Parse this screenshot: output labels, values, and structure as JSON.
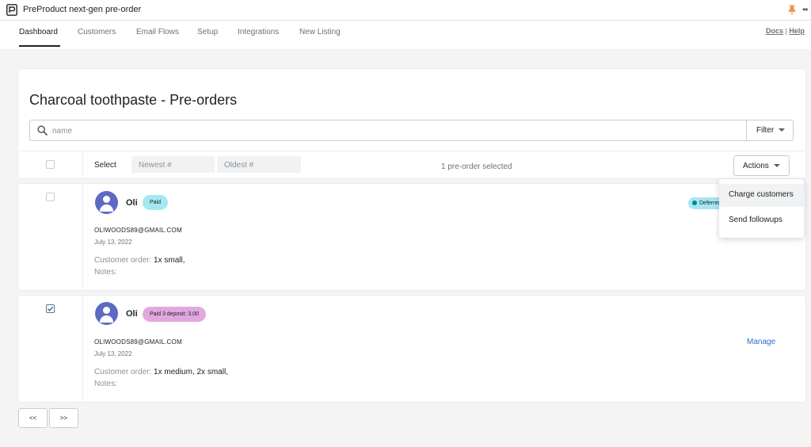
{
  "app": {
    "title": "PreProduct next-gen pre-order",
    "more_label": "••"
  },
  "nav": {
    "tabs": [
      {
        "label": "Dashboard"
      },
      {
        "label": "Customers"
      },
      {
        "label": "Email Flows"
      },
      {
        "label": "Setup"
      },
      {
        "label": "Integrations"
      },
      {
        "label": "New Listing"
      }
    ],
    "active_tab": "Dashboard",
    "docs_label": "Docs",
    "separator": "|",
    "help_label": "Help"
  },
  "page": {
    "title": "Charcoal toothpaste - Pre-orders",
    "search": {
      "placeholder": "name",
      "value": ""
    },
    "filter_label": "Filter"
  },
  "toolbar": {
    "select_label": "Select",
    "newest_placeholder": "Newest #",
    "oldest_placeholder": "Oldest #",
    "selected_info": "1 pre-order selected",
    "actions_label": "Actions"
  },
  "actions_menu": {
    "items": [
      {
        "label": "Charge customers"
      },
      {
        "label": "Send followups"
      }
    ]
  },
  "orders": [
    {
      "name": "Oli",
      "badge": "Paid",
      "badge_color": "#a4e8f2",
      "status": "Deferred",
      "email": "OLIWOODS89@GMAIL.COM",
      "date": "July 13, 2022",
      "order_label": "Customer order:",
      "order_value": " 1x small,",
      "notes_label": "Notes:",
      "checked": false
    },
    {
      "name": "Oli",
      "badge": "Paid 3 deposit: 3.00",
      "badge_color": "#e3a7e0",
      "email": "OLIWOODS89@GMAIL.COM",
      "date": "July 13, 2022",
      "order_label": "Customer order:",
      "order_value": " 1x medium, 2x small,",
      "notes_label": "Notes:",
      "manage_label": "Manage",
      "checked": true
    }
  ],
  "pagination": {
    "prev_label": "<<",
    "next_label": ">>"
  },
  "colors": {
    "accent": "#2c6ecb",
    "avatar": "#5c6ac4",
    "pin": "#f49342"
  },
  "icons": [
    "app-logo-icon",
    "pin-icon",
    "more-icon",
    "search-icon",
    "caret-down-icon",
    "avatar-icon",
    "checkmark-icon"
  ]
}
